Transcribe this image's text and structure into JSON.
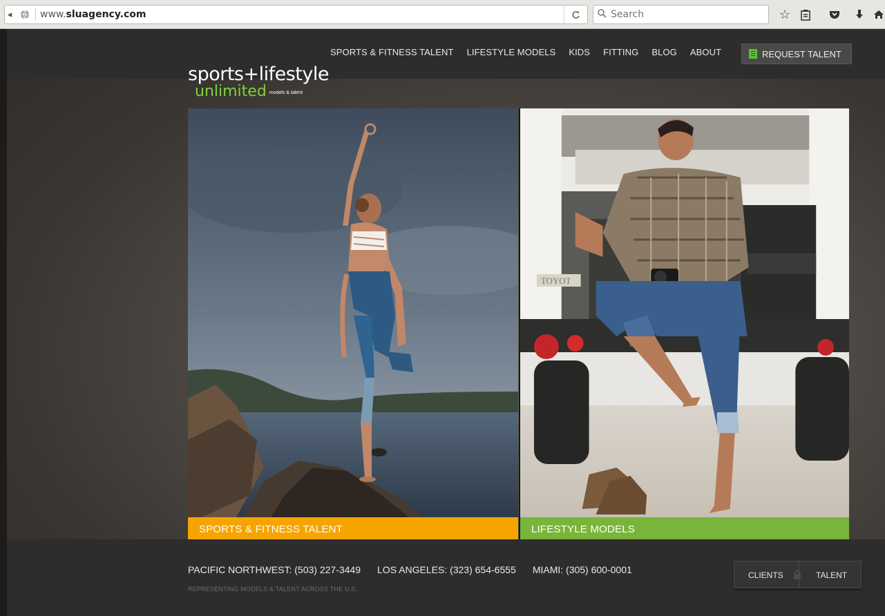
{
  "browser": {
    "url_prefix": "www.",
    "url_domain": "sluagency.com",
    "search_placeholder": "Search"
  },
  "nav": {
    "items": [
      "SPORTS & FITNESS TALENT",
      "LIFESTYLE MODELS",
      "KIDS",
      "FITTING",
      "BLOG",
      "ABOUT"
    ],
    "request_label": "REQUEST TALENT"
  },
  "logo": {
    "line1": "sports+lifestyle",
    "line2": "unlimited",
    "line3": "models & talent",
    "accent": "#7fd13b"
  },
  "panels": {
    "left_caption": "SPORTS & FITNESS TALENT",
    "left_color": "#f5a400",
    "right_caption": "LIFESTYLE MODELS",
    "right_color": "#79b53a"
  },
  "footer": {
    "contacts": [
      "PACIFIC NORTHWEST: (503) 227-3449",
      "LOS ANGELES: (323) 654-6555",
      "MIAMI: (305) 600-0001"
    ],
    "tagline": "REPRESENTING MODELS & TALENT ACROSS THE U.S.",
    "clients_label": "CLIENTS",
    "talent_label": "TALENT"
  }
}
